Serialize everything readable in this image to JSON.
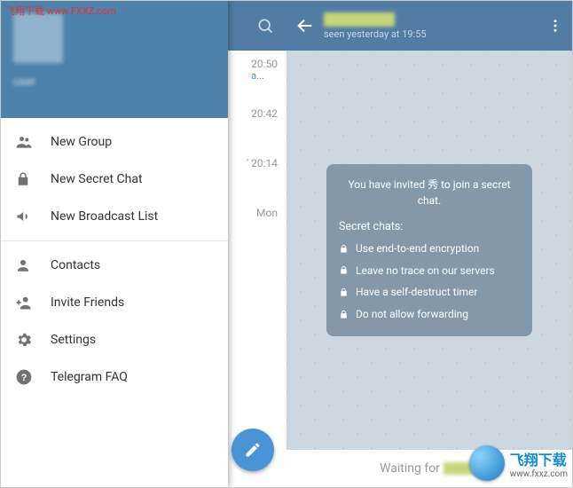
{
  "watermarks": {
    "top_left_label": "飞翔下载",
    "top_left_url": "www.FXXZ.com",
    "bottom_right_label": "飞翔下载",
    "bottom_right_url": "www.fxxz.com"
  },
  "drawer": {
    "items": [
      {
        "label": "New Group"
      },
      {
        "label": "New Secret Chat"
      },
      {
        "label": "New Broadcast List"
      },
      {
        "label": "Contacts"
      },
      {
        "label": "Invite Friends"
      },
      {
        "label": "Settings"
      },
      {
        "label": "Telegram FAQ"
      }
    ]
  },
  "chatlist": {
    "rows": [
      {
        "time": "20:50",
        "sub": "a..."
      },
      {
        "time": "20:42",
        "sub": ""
      },
      {
        "time": "20:14",
        "sub": ""
      },
      {
        "time": "Mon",
        "sub": ""
      }
    ]
  },
  "chat": {
    "last_seen": "seen yesterday at 19:55",
    "info_header": "You have invited 秀 to join a secret chat.",
    "section": "Secret chats:",
    "bullets": [
      "Use end-to-end encryption",
      "Leave no trace on our servers",
      "Have a self-destruct timer",
      "Do not allow forwarding"
    ],
    "footer": "Waiting for"
  }
}
